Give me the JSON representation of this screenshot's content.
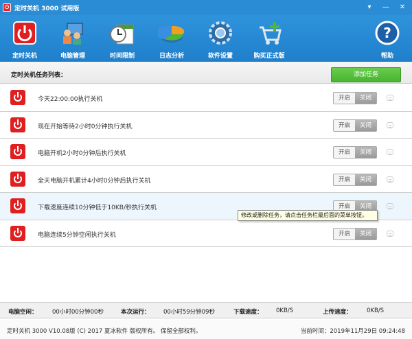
{
  "window": {
    "title": "定时关机 3000 试用版",
    "controls": [
      "▾",
      "—",
      "✕"
    ]
  },
  "toolbar": {
    "items": [
      {
        "label": "定时关机",
        "icon": "power-icon"
      },
      {
        "label": "电脑管理",
        "icon": "computer-people-icon"
      },
      {
        "label": "时间限制",
        "icon": "clock-icon"
      },
      {
        "label": "日志分析",
        "icon": "pie-chart-icon"
      },
      {
        "label": "软件设置",
        "icon": "gear-icon"
      },
      {
        "label": "购买正式版",
        "icon": "shopping-cart-icon"
      },
      {
        "label": "帮助",
        "icon": "help-icon"
      }
    ]
  },
  "list": {
    "caption": "定时关机任务列表：",
    "add_button": "添加任务",
    "tasks": [
      {
        "text": "今天22:00:00执行关机",
        "on": "开启",
        "off": "关闭"
      },
      {
        "text": "现在开始等待2小时0分钟执行关机",
        "on": "开启",
        "off": "关闭"
      },
      {
        "text": "电脑开机2小时0分钟后执行关机",
        "on": "开启",
        "off": "关闭"
      },
      {
        "text": "全天电脑开机累计4小时0分钟后执行关机",
        "on": "开启",
        "off": "关闭"
      },
      {
        "text": "下载速度连续10分钟低于10KB/秒执行关机",
        "on": "开启",
        "off": "关闭"
      },
      {
        "text": "电脑连续5分钟空闲执行关机",
        "on": "开启",
        "off": "关闭"
      }
    ],
    "tooltip": "修改或删除任务，请点击任务栏最后面的菜单按钮。"
  },
  "status": {
    "pc_idle_label": "电脑空闲：",
    "pc_idle_value": "00小时00分钟00秒",
    "run_label": "本次运行：",
    "run_value": "00小时59分钟09秒",
    "download_label": "下载速度：",
    "download_value": "0KB/S",
    "upload_label": "上传速度：",
    "upload_value": "0KB/S"
  },
  "footer": {
    "copyright": "定时关机 3000 V10.08版 (C) 2017  夏冰软件 版权所有。 保留全部权利。",
    "time_label": "当前时间：",
    "time_value": "2019年11月29日  09:24:48"
  },
  "colors": {
    "titlebar": "#2b8cd6",
    "toolbar": "#1f7fcb",
    "add_button": "#4cb833",
    "power_red": "#e02020"
  }
}
